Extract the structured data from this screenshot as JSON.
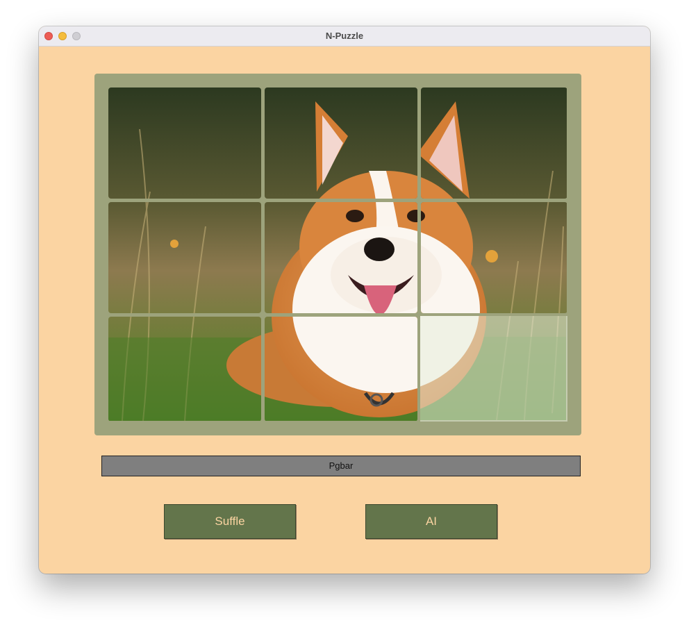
{
  "window": {
    "title": "N-Puzzle"
  },
  "puzzle": {
    "grid": "3x3",
    "image": "corgi-in-grass",
    "empty_tile": 9,
    "tiles": [
      1,
      2,
      3,
      4,
      5,
      6,
      7,
      8
    ]
  },
  "progress": {
    "label": "Pgbar",
    "value": 0
  },
  "buttons": {
    "shuffle": "Suffle",
    "ai": "AI"
  },
  "colors": {
    "background": "#fbd4a2",
    "board": "#9da37c",
    "button": "#63754b",
    "button_text": "#fbd4a2",
    "progress_bar": "#7f7f7f"
  }
}
